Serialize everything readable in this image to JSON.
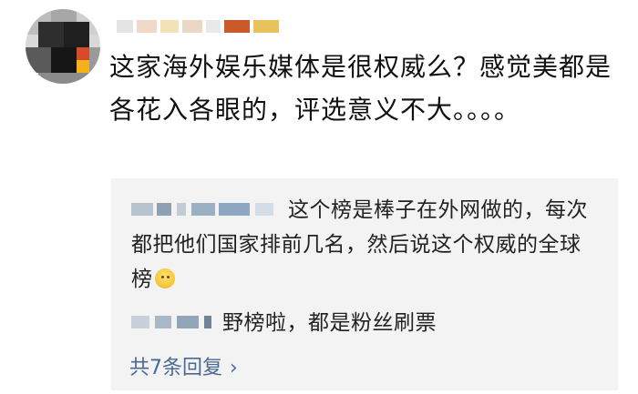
{
  "comment": {
    "text": "这家海外娱乐媒体是很权威么？感觉美都是各花入各眼的，评选意义不大。。。。"
  },
  "replies": [
    {
      "text": "这个榜是棒子在外网做的，每次都把他们国家排前几名，然后说这个权威的全球榜",
      "emoji": "hands-up-emoji"
    },
    {
      "text": "野榜啦，都是粉丝刷票"
    }
  ],
  "more_replies": {
    "label": "共7条回复",
    "chevron": "›"
  },
  "icons": {
    "avatar": "pixelated-avatar",
    "chevron": "chevron-right-icon"
  },
  "colors": {
    "text": "#111111",
    "reply_text": "#222222",
    "link": "#4a6a93",
    "panel_bg": "#f3f3f3"
  }
}
